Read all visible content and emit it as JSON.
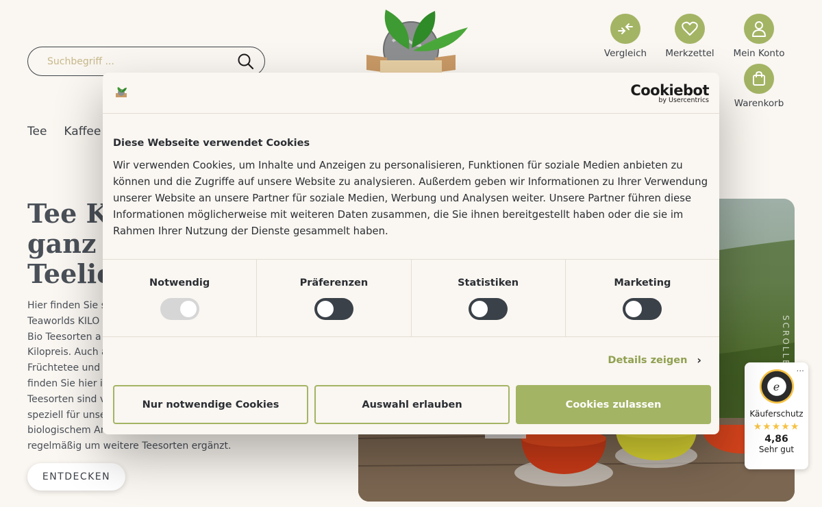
{
  "search": {
    "placeholder": "Suchbegriff ..."
  },
  "header": {
    "compare_label": "Vergleich",
    "wishlist_label": "Merkzettel",
    "account_label": "Mein Konto",
    "cart_label": "Warenkorb"
  },
  "nav": {
    "items": [
      "Tee",
      "Kaffee"
    ]
  },
  "hero": {
    "title_lines": [
      "Tee K",
      "ganz",
      "Teelie"
    ],
    "text_lines": [
      "Hier finden Sie s",
      "Teaworlds KILO",
      "Bio Teesorten a",
      "Kilopreis. Auch a",
      "Früchtetee und",
      "finden Sie hier i",
      "Teesorten sind v",
      "speziell für unse",
      "biologischem An",
      "regelmäßig um weitere Teesorten ergänzt."
    ],
    "button_label": "ENTDECKEN",
    "scroll_label": "SCROLLEN"
  },
  "trusted_shops": {
    "more_label": "...",
    "label": "Käuferschutz",
    "stars": "★★★★★",
    "score": "4,86",
    "rating_text": "Sehr gut",
    "seal_letter": "e"
  },
  "cookie": {
    "brand_name": "Cookiebot",
    "brand_by": "by Usercentrics",
    "title": "Diese Webseite verwendet Cookies",
    "body": "Wir verwenden Cookies, um Inhalte und Anzeigen zu personalisieren, Funktionen für soziale Medien anbieten zu können und die Zugriffe auf unsere Website zu analysieren. Außerdem geben wir Informationen zu Ihrer Verwendung unserer Website an unsere Partner für soziale Medien, Werbung und Analysen weiter. Unsere Partner führen diese Informationen möglicherweise mit weiteren Daten zusammen, die Sie ihnen bereitgestellt haben oder die sie im Rahmen Ihrer Nutzung der Dienste gesammelt haben.",
    "categories": [
      {
        "label": "Notwendig",
        "enabled": true,
        "locked": true
      },
      {
        "label": "Präferenzen",
        "enabled": false,
        "locked": false
      },
      {
        "label": "Statistiken",
        "enabled": false,
        "locked": false
      },
      {
        "label": "Marketing",
        "enabled": false,
        "locked": false
      }
    ],
    "details_label": "Details zeigen",
    "details_chevron": "›",
    "btn_necessary": "Nur notwendige Cookies",
    "btn_selection": "Auswahl erlauben",
    "btn_all": "Cookies zulassen"
  },
  "colors": {
    "accent": "#a3b464",
    "text": "#3c4248",
    "background": "#faf6f1"
  }
}
